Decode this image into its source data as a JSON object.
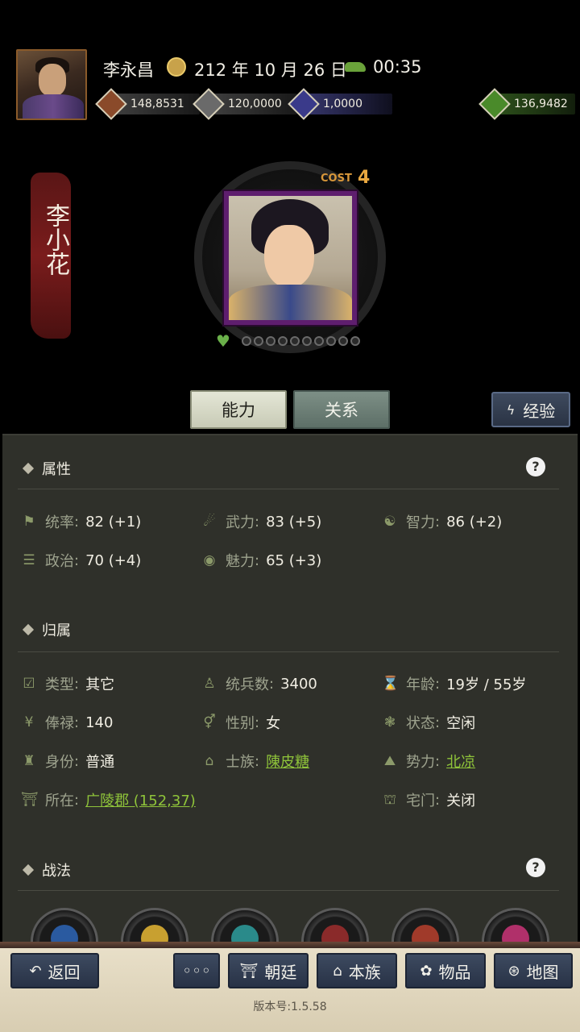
{
  "header": {
    "player_name": "李永昌",
    "date": "212 年 10 月 26 日",
    "time": "00:35",
    "resources": [
      "148,8531",
      "120,0000",
      "1,0000",
      "136,9482"
    ]
  },
  "character": {
    "name": "李小花",
    "cost_label": "COST",
    "cost_value": "4"
  },
  "tabs": {
    "ability": "能力",
    "relation": "关系",
    "exp": "经验"
  },
  "attributes": {
    "title": "属性",
    "stats": [
      {
        "label": "统率",
        "value": "82 (+1)"
      },
      {
        "label": "武力",
        "value": "83 (+5)"
      },
      {
        "label": "智力",
        "value": "86 (+2)"
      },
      {
        "label": "政治",
        "value": "70 (+4)"
      },
      {
        "label": "魅力",
        "value": "65 (+3)"
      }
    ]
  },
  "affiliation": {
    "title": "归属",
    "fields": [
      {
        "label": "类型",
        "value": "其它"
      },
      {
        "label": "统兵数",
        "value": "3400"
      },
      {
        "label": "年龄",
        "value": "19岁 / 55岁"
      },
      {
        "label": "俸禄",
        "value": "140"
      },
      {
        "label": "性别",
        "value": "女"
      },
      {
        "label": "状态",
        "value": "空闲"
      },
      {
        "label": "身份",
        "value": "普通"
      },
      {
        "label": "士族",
        "value": "陳皮糖"
      },
      {
        "label": "势力",
        "value": "北凉"
      },
      {
        "label": "所在",
        "value": "广陵郡 (152,37)"
      },
      {
        "label": "宅门",
        "value": "关闭"
      }
    ]
  },
  "tactics": {
    "title": "战法"
  },
  "help_symbol": "?",
  "bottom": {
    "back": "返回",
    "more": "◦◦◦",
    "court": "朝廷",
    "clan": "本族",
    "items": "物品",
    "map": "地图",
    "version": "版本号:1.5.58"
  },
  "colors": {
    "link": "#8fc43a",
    "panel": "#2f302a",
    "banner": "#7a1c1c",
    "portrait_border": "#5e1e6e"
  }
}
